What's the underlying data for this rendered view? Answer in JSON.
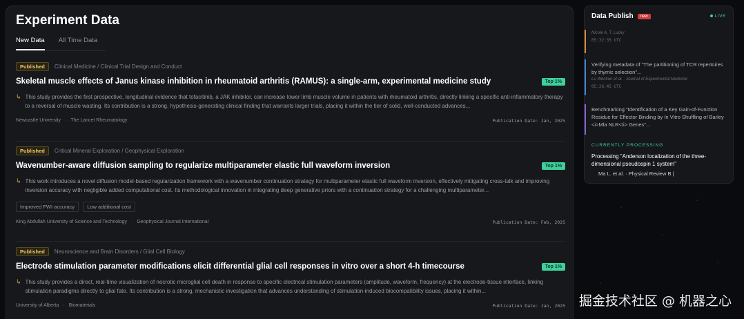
{
  "main": {
    "title": "Experiment Data",
    "tabs": [
      "New Data",
      "All Time Data"
    ]
  },
  "cards": [
    {
      "status": "Published",
      "category": "Clinical Medicine / Clinical Trial Design and Conduct",
      "title": "Skeletal muscle effects of Janus kinase inhibition in rheumatoid arthritis (RAMUS): a single-arm, experimental medicine study",
      "badge": "Top 1%",
      "summary": "This study provides the first prospective, longitudinal evidence that tofacitinib, a JAK inhibitor, can increase lower limb muscle volume in patients with rheumatoid arthritis, directly linking a specific anti-inflammatory therapy to a reversal of muscle wasting. Its contribution is a strong, hypothesis-generating clinical finding that warrants larger trials, placing it within the tier of solid, well-conducted advances...",
      "tags": [],
      "institution": "Newcastle University",
      "journal": "The Lancet Rheumatology",
      "date": "Publication Date: Jan, 2025"
    },
    {
      "status": "Published",
      "category": "Critical Mineral Exploration / Geophysical Exploration",
      "title": "Wavenumber-aware diffusion sampling to regularize multiparameter elastic full waveform inversion",
      "badge": "Top 1%",
      "summary": "This work introduces a novel diffusion model-based regularization framework with a wavenumber continuation strategy for multiparameter elastic full waveform inversion, effectively mitigating cross-talk and improving inversion accuracy with negligible added computational cost. Its methodological innovation in integrating deep generative priors with a continuation strategy for a challenging multiparameter...",
      "tags": [
        "Improved FWI accuracy",
        "Low additional cost"
      ],
      "institution": "King Abdullah University of Science and Technology",
      "journal": "Geophysical Journal International",
      "date": "Publication Date: Feb, 2025"
    },
    {
      "status": "Published",
      "category": "Neuroscience and Brain Disorders / Glial Cell Biology",
      "title": "Electrode stimulation parameter modifications elicit differential glial cell responses in vitro over a short 4-h timecourse",
      "badge": "Top 1%",
      "summary": "This study provides a direct, real-time visualization of necrotic microglial cell death in response to specific electrical stimulation parameters (amplitude, waveform, frequency) at the electrode-tissue interface, linking stimulation paradigms directly to glial fate. Its contribution is a strong, mechanistic investigation that advances understanding of stimulation-induced biocompatibility issues, placing it within...",
      "tags": [],
      "institution": "University of Alberta",
      "journal": "Biomaterials",
      "date": "Publication Date: Jan, 2025"
    }
  ],
  "side": {
    "title": "Data Publish",
    "new_badge": "new",
    "live": "LIVE",
    "feed": [
      {
        "title": "",
        "sub": "Nicole A. T. Lucky",
        "time": "05:32:35 UTC",
        "color": "#d98a3a"
      },
      {
        "title": "Verifying metadata of \"The partitioning of TCR repertoires by thymic selection\"...",
        "sub": "Lu Wenkun et al. · Journal of Experimental Medicine",
        "time": "05:26:45 UTC",
        "color": "#4a7fd6"
      },
      {
        "title": "Benchmarking \"Identification of a Key Gain-of-Function Residue for Effector Binding by In Vitro Shuffling of Barley <i>Mla NLR</i> Genes\"...",
        "sub": "",
        "time": "",
        "color": "#8a5fd0"
      }
    ],
    "processing_label": "CURRENTLY PROCESSING",
    "processing_text": "Processing \"Anderson localization of the three-dimensional pseudospin 1 system\"",
    "processing_sub": "Ma L. et al. · Physical Review B |"
  },
  "watermark": "掘金技术社区 @ 机器之心"
}
